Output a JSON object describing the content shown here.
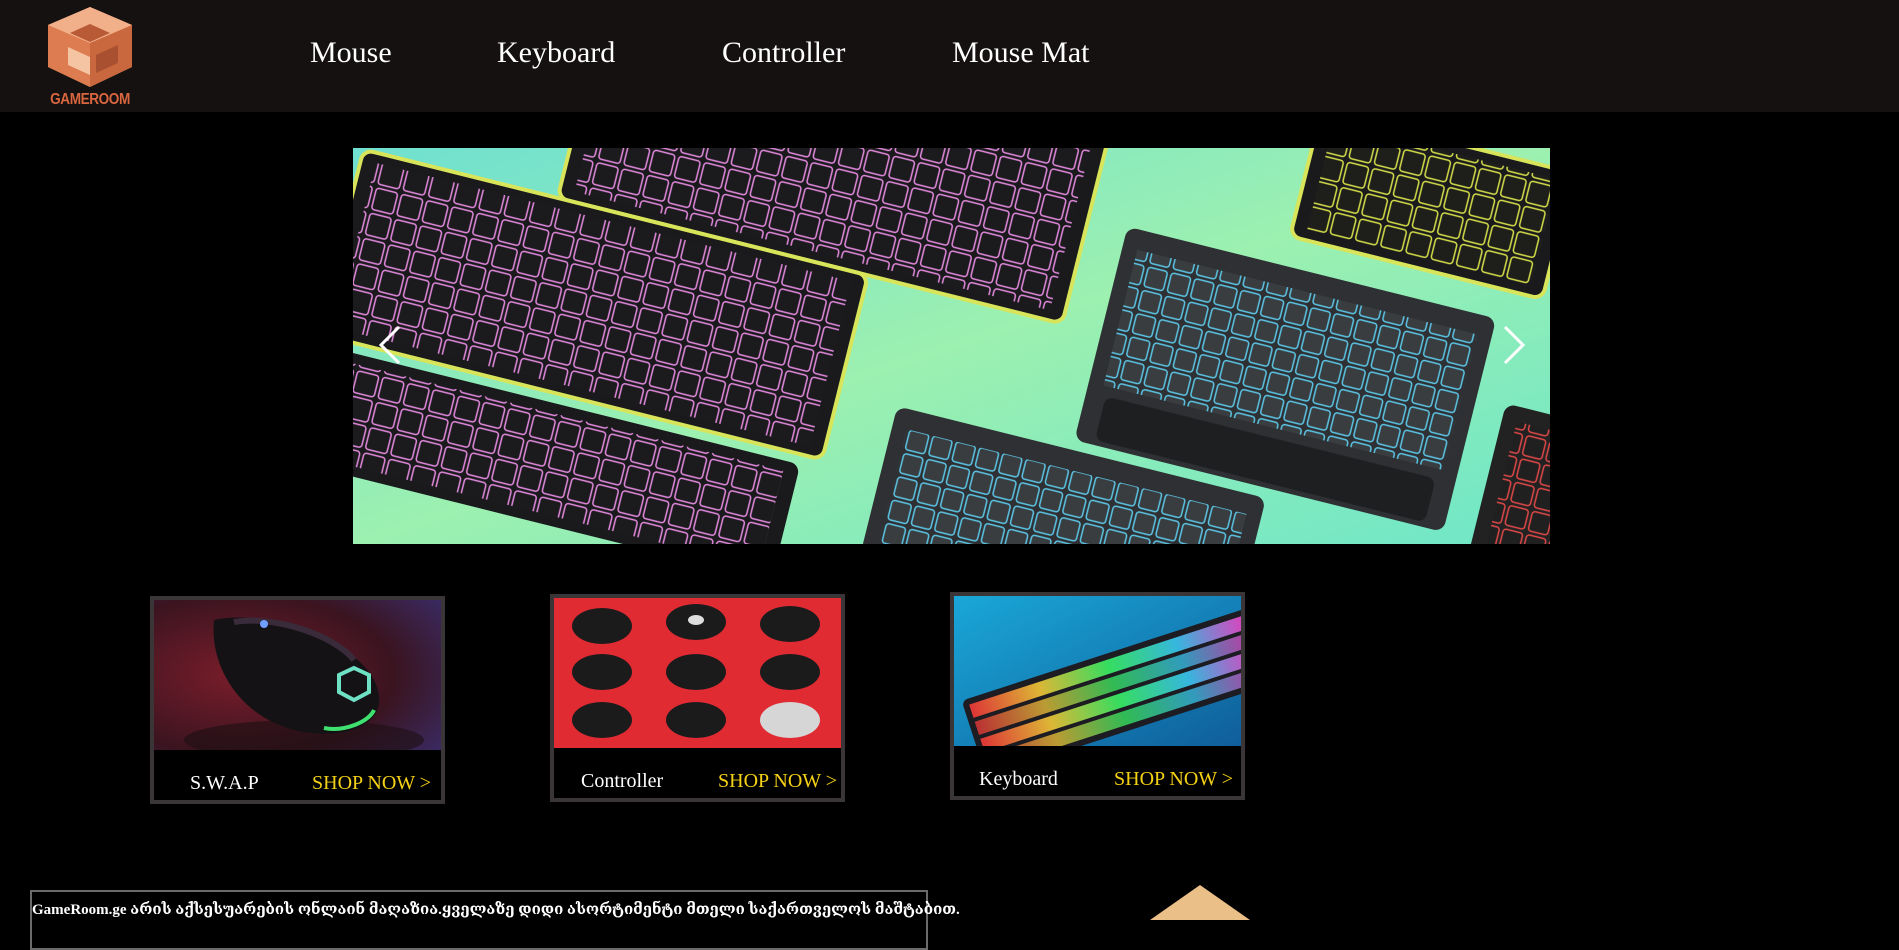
{
  "brand": {
    "name": "GAMEROOM",
    "logo_color": "#d9663f"
  },
  "nav": [
    {
      "label": "Mouse"
    },
    {
      "label": "Keyboard"
    },
    {
      "label": "Controller"
    },
    {
      "label": "Mouse Mat"
    }
  ],
  "slider": {
    "prev_icon": "chevron-left-icon",
    "next_icon": "chevron-right-icon"
  },
  "cards": [
    {
      "name": "S.W.A.P",
      "cta": "SHOP NOW >"
    },
    {
      "name": "Controller",
      "cta": "SHOP NOW >"
    },
    {
      "name": "Keyboard",
      "cta": "SHOP NOW >"
    }
  ],
  "about": {
    "text": "GameRoom.ge არის აქსესუარების ონლაინ მაღაზია.ყველაზე დიდი ასორტიმენტი მთელი საქართველოს მაშტაბით."
  },
  "colors": {
    "header_bg": "#141110",
    "accent_cta": "#f5d116",
    "card_border": "#3a3637"
  }
}
